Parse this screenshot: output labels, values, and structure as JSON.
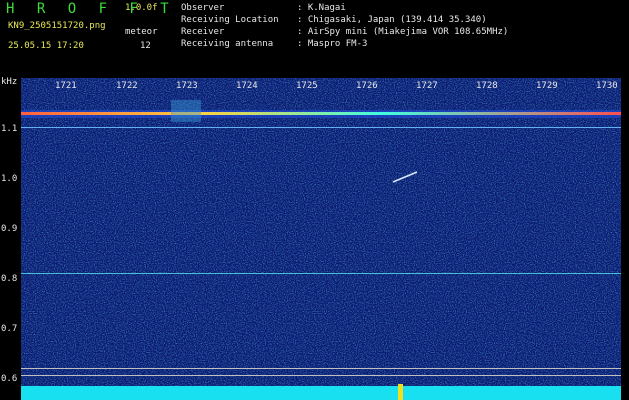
{
  "app": {
    "title": "H R O F F T",
    "version": "1.0.0f",
    "filename": "KN9_2505151720.png",
    "meteor_label": "meteor",
    "datetime": "25.05.15 17:20",
    "meteor_count": "12"
  },
  "info": [
    {
      "label": "Observer",
      "value": ": K.Nagai"
    },
    {
      "label": "Receiving Location",
      "value": ": Chigasaki, Japan (139.414 35.340)"
    },
    {
      "label": "Receiver",
      "value": ": AirSpy mini (Miakejima VOR 108.65MHz)"
    },
    {
      "label": "Receiving antenna",
      "value": ": Maspro FM-3"
    }
  ],
  "axes": {
    "y_unit": "kHz",
    "y_ticks": [
      "1.1",
      "1.0",
      "0.9",
      "0.8",
      "0.7",
      "0.6"
    ],
    "x_ticks": [
      "1721",
      "1722",
      "1723",
      "1724",
      "1725",
      "1726",
      "1727",
      "1728",
      "1729",
      "1730"
    ]
  },
  "colors": {
    "background": "#000000",
    "spectrogram_base": "#0a1870",
    "carrier_band": "#ff5050",
    "accent_green": "#3ddc3d",
    "accent_yellow": "#e8e85a"
  }
}
